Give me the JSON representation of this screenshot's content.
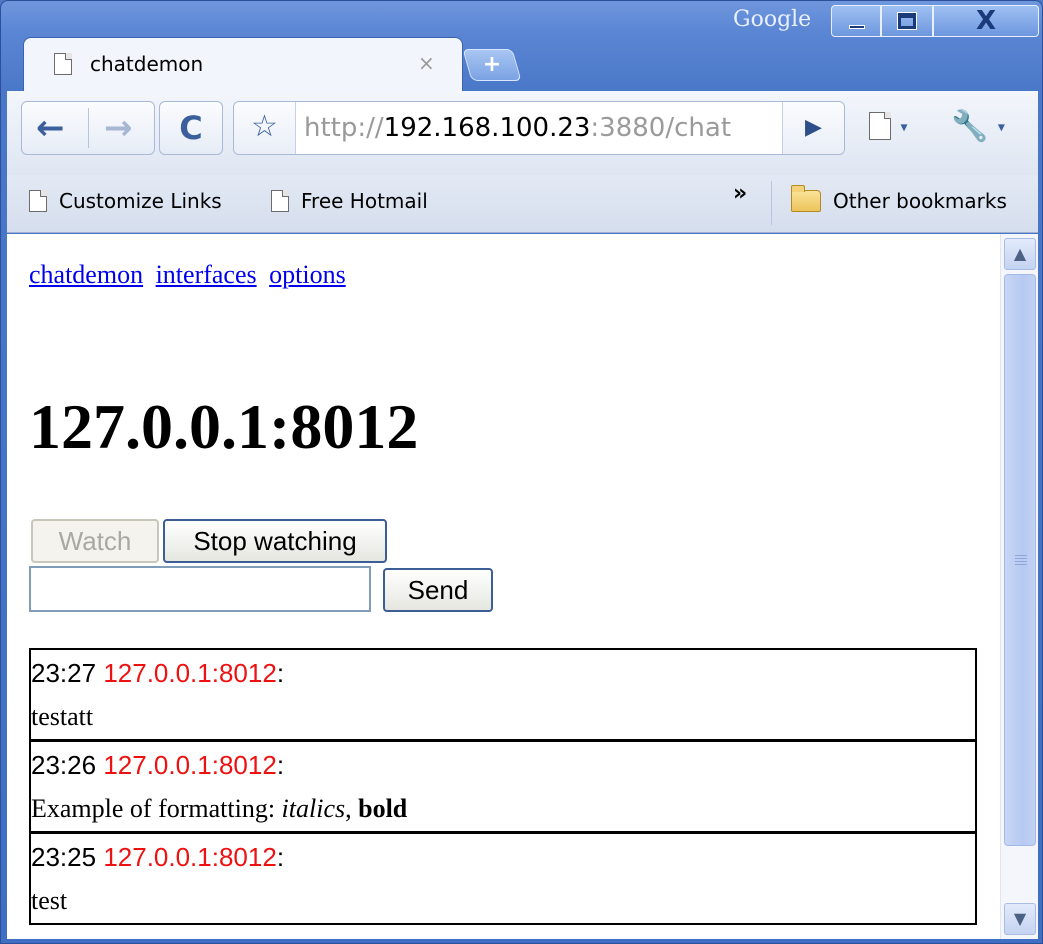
{
  "window": {
    "brand": "Google",
    "controls": {
      "minimize": "–",
      "maximize": "□",
      "close": "X"
    }
  },
  "tabs": [
    {
      "title": "chatdemon",
      "close": "×"
    }
  ],
  "new_tab_label": "+",
  "toolbar": {
    "url_scheme": "http://",
    "url_host": "192.168.100.23",
    "url_rest": ":3880/chat",
    "go_glyph": "▶",
    "page_menu_glyph": "▾",
    "tools_menu_glyph": "▾"
  },
  "bookmarks": {
    "items": [
      "Customize Links",
      "Free Hotmail"
    ],
    "overflow": "»",
    "other": "Other bookmarks"
  },
  "page": {
    "nav_links": [
      "chatdemon",
      "interfaces",
      "options"
    ],
    "heading": "127.0.0.1:8012",
    "watch_label": "Watch",
    "stop_label": "Stop watching",
    "message_input_value": "",
    "send_label": "Send",
    "messages": [
      {
        "time": "23:27",
        "sender": "127.0.0.1:8012",
        "colon": ":",
        "body": "testatt"
      },
      {
        "time": "23:26",
        "sender": "127.0.0.1:8012",
        "colon": ":",
        "body_plain": "Example of formatting: ",
        "body_italic": "italics",
        "body_sep": ", ",
        "body_bold": "bold"
      },
      {
        "time": "23:25",
        "sender": "127.0.0.1:8012",
        "colon": ":",
        "body": "test"
      }
    ]
  },
  "colors": {
    "link": "#0000ee",
    "sender": "#ee1111",
    "frame": "#4f78c4"
  },
  "icons": {
    "back": "back-arrow-icon",
    "forward": "forward-arrow-icon",
    "reload": "reload-icon",
    "star": "star-icon",
    "page_menu": "page-icon",
    "tools_menu": "wrench-icon",
    "bookmark_page": "page-icon",
    "folder": "folder-icon"
  }
}
